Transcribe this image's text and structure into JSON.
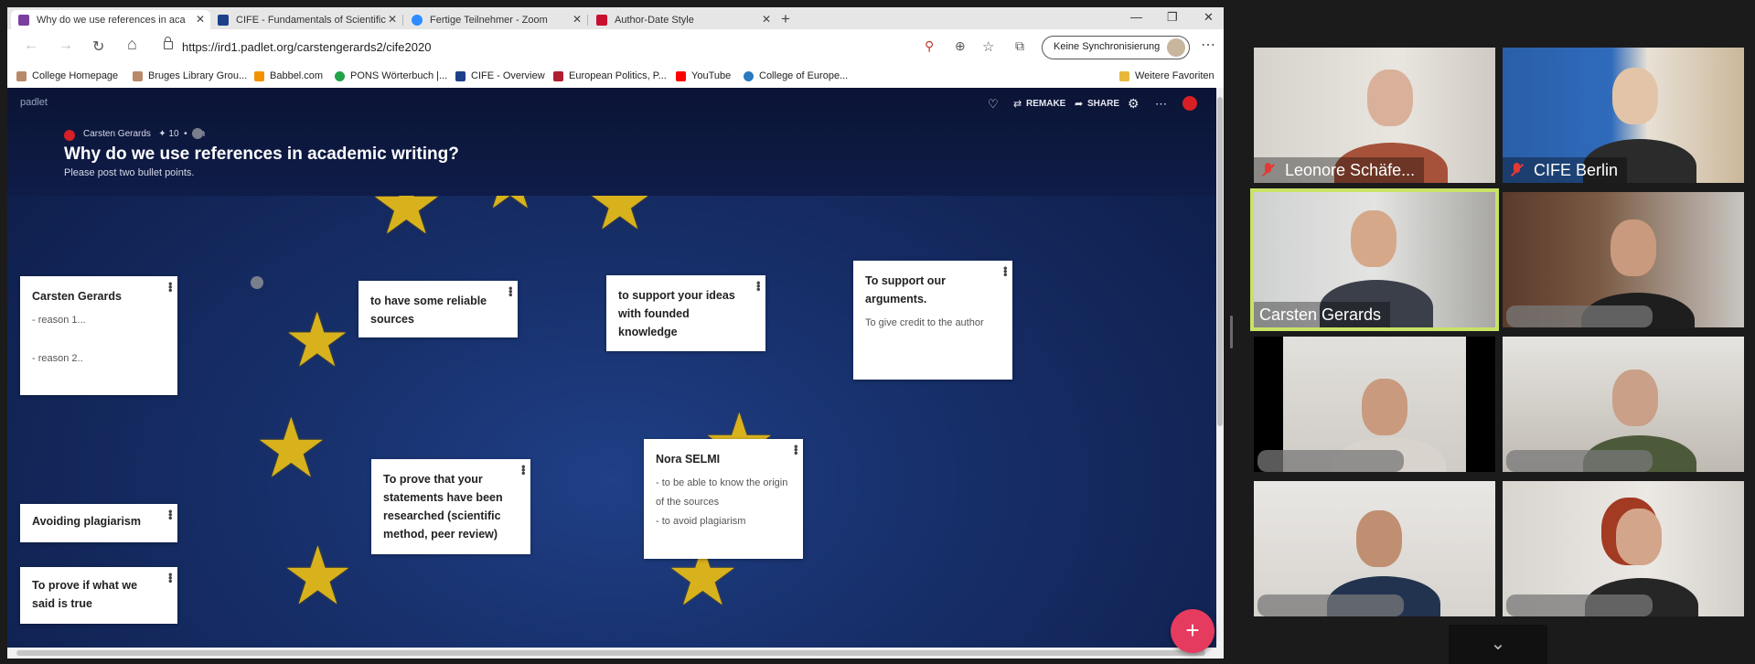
{
  "browser": {
    "tabs": [
      {
        "title": "Why do we use references in aca",
        "favicon_color": "#7b3fa0",
        "active": true
      },
      {
        "title": "CIFE - Fundamentals of Scientific",
        "favicon_color": "#1c3f8a",
        "active": false
      },
      {
        "title": "Fertige Teilnehmer - Zoom",
        "favicon_color": "#2d8cff",
        "active": false
      },
      {
        "title": "Author-Date Style",
        "favicon_color": "#c8102e",
        "active": false
      }
    ],
    "tab_close": "✕",
    "new_tab": "+",
    "window_controls": {
      "minimize": "—",
      "restore": "❐",
      "close": "✕"
    },
    "nav": {
      "back": "←",
      "forward": "→",
      "refresh": "↻",
      "home": "⌂"
    },
    "url": "https://ird1.padlet.org/carstengerards2/cife2020",
    "toolbar_icons": {
      "tracking": "⚲",
      "add": "⊕",
      "favorite": "☆",
      "collections": "⧉",
      "more": "⋯"
    },
    "sync_label": "Keine Synchronisierung",
    "bookmarks": [
      {
        "label": "College Homepage",
        "color": "#b88a6a"
      },
      {
        "label": "Bruges Library Grou...",
        "color": "#b88a6a"
      },
      {
        "label": "Babbel.com",
        "color": "#f39200"
      },
      {
        "label": "PONS Wörterbuch |...",
        "color": "#22a34b"
      },
      {
        "label": "CIFE - Overview",
        "color": "#1c3f8a"
      },
      {
        "label": "European Politics, P...",
        "color": "#b01e2f"
      },
      {
        "label": "YouTube",
        "color": "#ff0000"
      },
      {
        "label": "College of Europe...",
        "color": "#2a7abf"
      }
    ],
    "other_favorites": "Weitere Favoriten"
  },
  "padlet": {
    "brand": "padlet",
    "header_actions": {
      "like_icon": "♡",
      "remake": "REMAKE",
      "share": "SHARE",
      "remake_icon": "⇄",
      "share_icon": "➦",
      "settings_icon": "⚙",
      "more_icon": "⋯"
    },
    "author": "Carsten Gerards",
    "meta_count": "✦ 10",
    "meta_sep": "•",
    "meta_time": "1m",
    "title": "Why do we use references in academic writing?",
    "subtitle": "Please post two bullet points.",
    "cards": [
      {
        "title": "Carsten Gerards",
        "body": "- reason 1...\n\n- reason 2.."
      },
      {
        "title": "to have some reliable sources",
        "body": ""
      },
      {
        "title": "to support your ideas with founded knowledge",
        "body": ""
      },
      {
        "title": "To support our arguments.",
        "body": "To give credit to the author"
      },
      {
        "title": "Avoiding plagiarism",
        "body": ""
      },
      {
        "title": "To prove if what we said is true",
        "body": ""
      },
      {
        "title": "To prove that your statements have been researched (scientific method, peer review)",
        "body": ""
      },
      {
        "title": "Nora SELMI",
        "body": "- to be able to know the origin of the sources\n- to avoid plagiarism"
      }
    ],
    "card_menu": "•••",
    "fab_label": "+"
  },
  "zoom": {
    "participants": [
      {
        "name": "Leonore Schäfe...",
        "muted": true
      },
      {
        "name": "CIFE Berlin",
        "muted": true
      },
      {
        "name": "Carsten Gerards",
        "muted": false
      },
      {
        "name": "",
        "muted": false
      },
      {
        "name": "",
        "muted": false
      },
      {
        "name": "",
        "muted": false
      },
      {
        "name": "",
        "muted": false
      },
      {
        "name": "",
        "muted": false
      }
    ],
    "chevron": "⌄"
  }
}
